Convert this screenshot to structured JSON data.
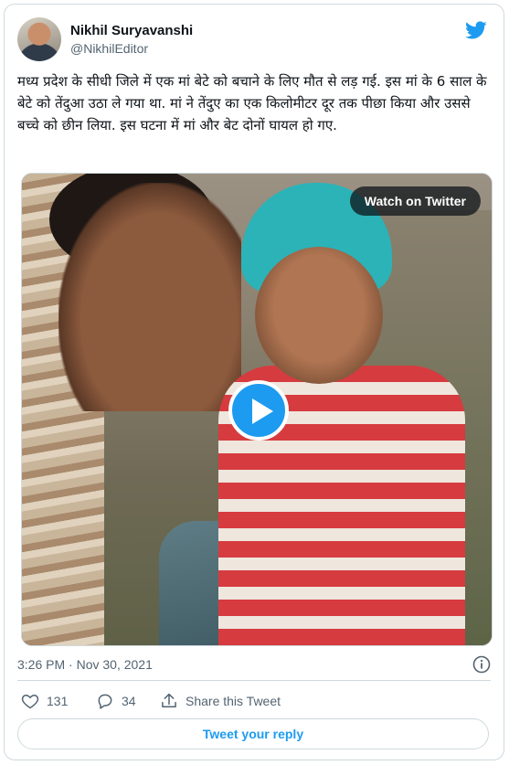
{
  "author": {
    "display_name": "Nikhil Suryavanshi",
    "handle": "@NikhilEditor"
  },
  "tweet": {
    "text": "मध्य प्रदेश के सीधी जिले में एक मां बेटे को बचाने के लिए मौत से लड़ गई. इस मां के 6 साल के बेटे को तेंदुआ उठा ले गया था. मां ने तेंदुए का एक किलोमीटर दूर तक पीछा किया और उससे बच्चे को छीन लिया. इस घटना में मां और बेट दोनों घायल हो गए.",
    "timestamp": "3:26 PM · Nov 30, 2021"
  },
  "media": {
    "watch_label": "Watch on Twitter"
  },
  "actions": {
    "likes": "131",
    "replies": "34",
    "share_label": "Share this Tweet"
  },
  "reply_button_label": "Tweet your reply",
  "colors": {
    "accent": "#1d9bf0",
    "text": "#0f1419",
    "muted": "#536471",
    "border": "#cfd9de"
  },
  "icons": [
    "twitter-bird-icon",
    "play-icon",
    "info-icon",
    "heart-icon",
    "reply-icon",
    "share-icon"
  ]
}
